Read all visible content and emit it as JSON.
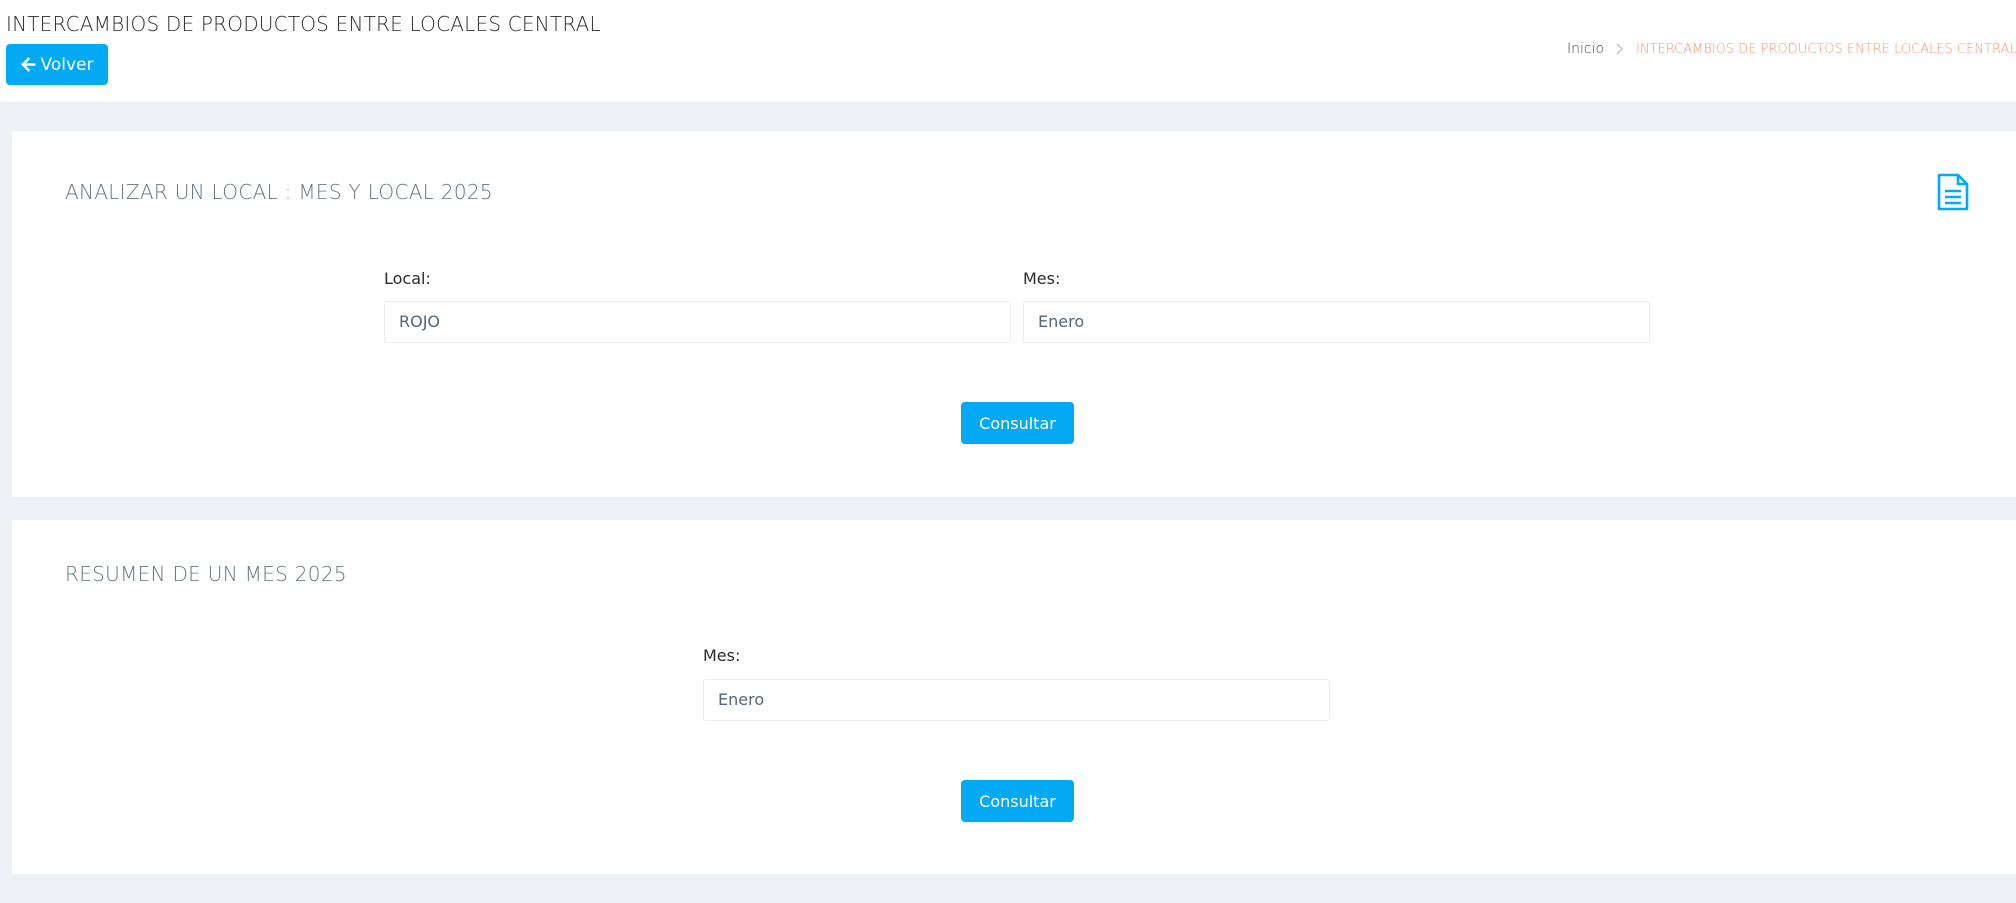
{
  "header": {
    "title": "INTERCAMBIOS DE PRODUCTOS ENTRE LOCALES CENTRAL",
    "back_label": "Volver",
    "breadcrumb": {
      "home": "Inicio",
      "current": "INTERCAMBIOS DE PRODUCTOS ENTRE LOCALES CENTRAL"
    }
  },
  "section_local": {
    "title": "ANALIZAR UN LOCAL : MES Y LOCAL 2025",
    "local_label": "Local:",
    "local_value": "ROJO",
    "mes_label": "Mes:",
    "mes_value": "Enero",
    "submit_label": "Consultar"
  },
  "section_mes": {
    "title": "RESUMEN DE UN MES 2025",
    "mes_label": "Mes:",
    "mes_value": "Enero",
    "submit_label": "Consultar"
  },
  "icons": {
    "back": "arrow-left-icon",
    "breadcrumb_separator": "chevron-right-icon",
    "report": "document-icon"
  },
  "colors": {
    "primary": "#03a9f3",
    "breadcrumb_active": "#fb9678",
    "page_background": "#edf1f5",
    "card_title": "#67757c"
  }
}
